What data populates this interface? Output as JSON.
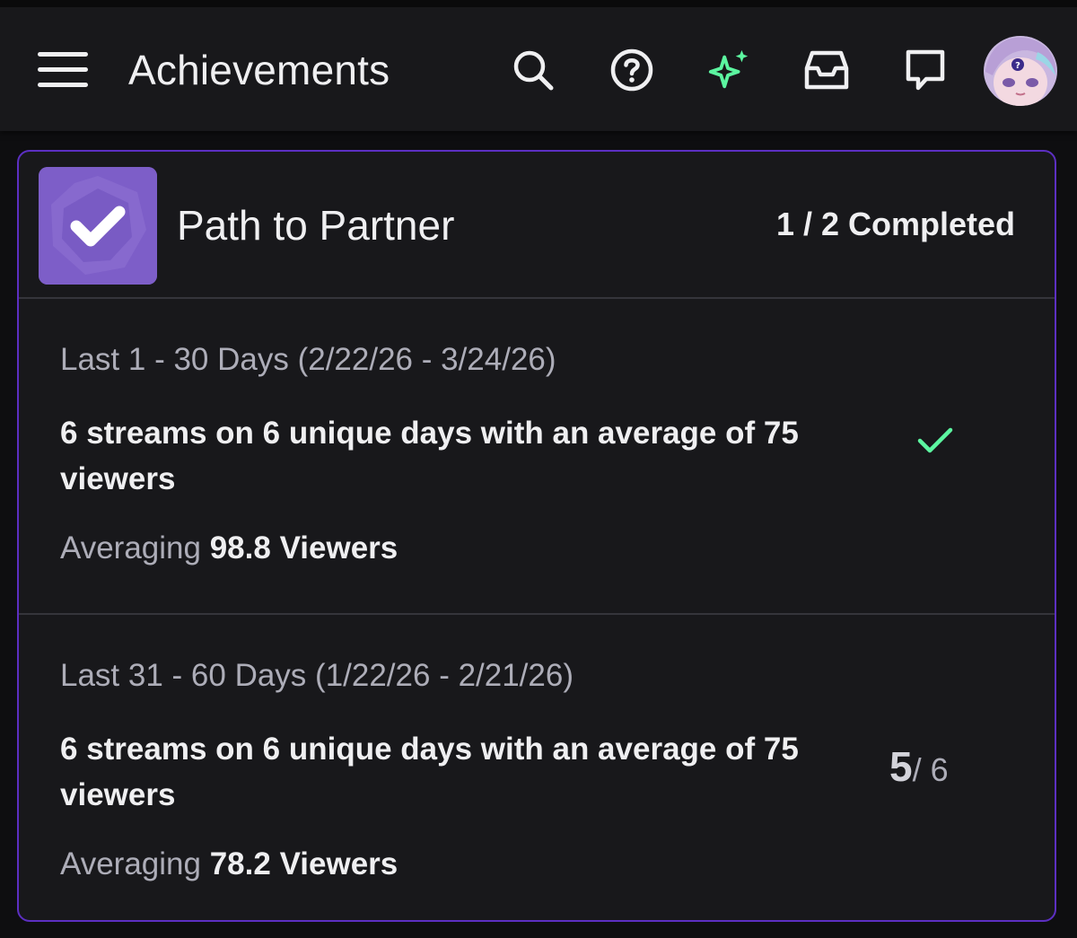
{
  "header": {
    "title": "Achievements",
    "icons": [
      "menu-icon",
      "search-icon",
      "help-icon",
      "sparkle-icon",
      "inbox-icon",
      "whispers-icon",
      "avatar"
    ],
    "accent_color": "#5cf5a0"
  },
  "card": {
    "title": "Path to Partner",
    "progress": "1 / 2 Completed",
    "border_color": "#5c2fc2",
    "badge_color": "#7b5cc4",
    "sections": [
      {
        "period": "Last 1 - 30 Days (2/22/26 - 3/24/26)",
        "requirement": "6 streams on 6 unique days with an average of 75 viewers",
        "averaging_label": "Averaging",
        "averaging_value": "98.8 Viewers",
        "status": "completed",
        "status_icon": "check-icon"
      },
      {
        "period": "Last 31 - 60 Days (1/22/26 - 2/21/26)",
        "requirement": "6 streams on 6 unique days with an average of 75 viewers",
        "averaging_label": "Averaging",
        "averaging_value": "78.2 Viewers",
        "count_current": "5",
        "count_total": "/ 6"
      }
    ]
  }
}
